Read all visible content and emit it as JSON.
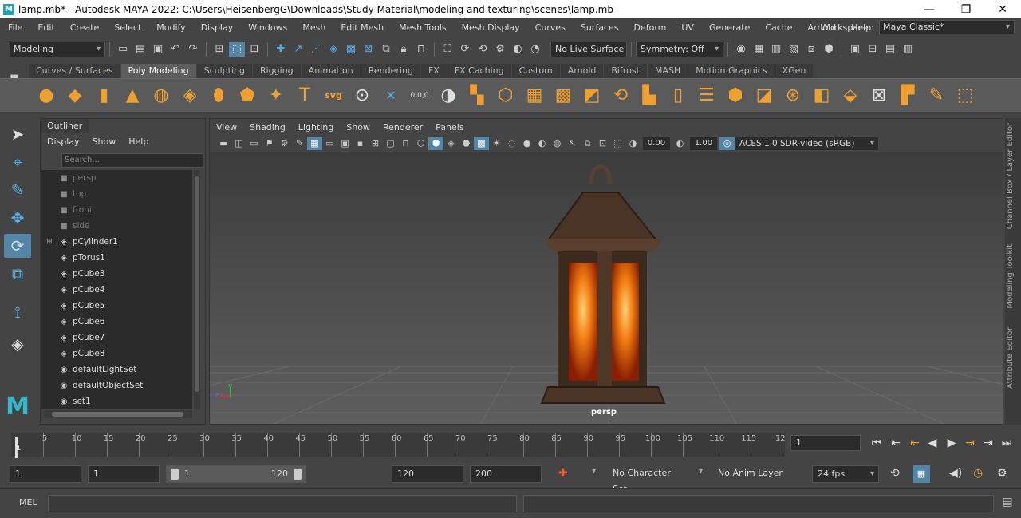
{
  "window": {
    "title": "lamp.mb* - Autodesk MAYA 2022: C:\\Users\\HeisenbergG\\Downloads\\Study Material\\modeling and texturing\\scenes\\lamp.mb",
    "logo": "M",
    "minimize": "—",
    "restore": "❐",
    "close": "✕"
  },
  "menubar": {
    "items": [
      "File",
      "Edit",
      "Create",
      "Select",
      "Modify",
      "Display",
      "Windows",
      "Mesh",
      "Edit Mesh",
      "Mesh Tools",
      "Mesh Display",
      "Curves",
      "Surfaces",
      "Deform",
      "UV",
      "Generate",
      "Cache",
      "Arnold",
      "Help"
    ],
    "workspace_label": "Workspace :",
    "workspace_value": "Maya Classic*"
  },
  "statusline": {
    "mode": "Modeling",
    "live_surface": "No Live Surface",
    "symmetry": "Symmetry: Off"
  },
  "shelf": {
    "tabs": [
      "Curves / Surfaces",
      "Poly Modeling",
      "Sculpting",
      "Rigging",
      "Animation",
      "Rendering",
      "FX",
      "FX Caching",
      "Custom",
      "Arnold",
      "Bifrost",
      "MASH",
      "Motion Graphics",
      "XGen"
    ],
    "active_tab": "Poly Modeling",
    "tools": [
      "sphere-icon",
      "cube-icon",
      "cylinder-icon",
      "cone-icon",
      "torus-icon",
      "plane-icon",
      "disc-icon",
      "platonic-icon",
      "sweep-icon",
      "type-icon",
      "svg-icon",
      "measure-icon",
      "snap-icon",
      "sphere-polygon-icon",
      "combine-icon",
      "separate-icon",
      "smooth-icon",
      "extrude-icon",
      "bridge-icon",
      "bevel-icon",
      "multicut-icon",
      "target-weld-icon",
      "offset-icon",
      "bevel2-icon",
      "fill-icon",
      "sculpt-icon",
      "quad-draw-icon",
      "bridge2-icon",
      "unfold-icon",
      "pencil-icon",
      "uv-icon"
    ],
    "svg_label": "svg",
    "type_label": "T",
    "snap_value": "0,0,0"
  },
  "outliner": {
    "tab": "Outliner",
    "menu": [
      "Display",
      "Show",
      "Help"
    ],
    "search_placeholder": "Search...",
    "items": [
      {
        "label": "persp",
        "icon": "camera-icon",
        "dim": true
      },
      {
        "label": "top",
        "icon": "camera-icon",
        "dim": true
      },
      {
        "label": "front",
        "icon": "camera-icon",
        "dim": true
      },
      {
        "label": "side",
        "icon": "camera-icon",
        "dim": true
      },
      {
        "label": "pCylinder1",
        "icon": "mesh-icon",
        "dim": false,
        "expand": true
      },
      {
        "label": "pTorus1",
        "icon": "mesh-icon",
        "dim": false
      },
      {
        "label": "pCube3",
        "icon": "mesh-icon",
        "dim": false
      },
      {
        "label": "pCube4",
        "icon": "mesh-icon",
        "dim": false
      },
      {
        "label": "pCube5",
        "icon": "mesh-icon",
        "dim": false
      },
      {
        "label": "pCube6",
        "icon": "mesh-icon",
        "dim": false
      },
      {
        "label": "pCube7",
        "icon": "mesh-icon",
        "dim": false
      },
      {
        "label": "pCube8",
        "icon": "mesh-icon",
        "dim": false
      },
      {
        "label": "defaultLightSet",
        "icon": "set-icon",
        "dim": false
      },
      {
        "label": "defaultObjectSet",
        "icon": "set-icon",
        "dim": false
      },
      {
        "label": "set1",
        "icon": "set-icon",
        "dim": false
      }
    ]
  },
  "viewport": {
    "menu": [
      "View",
      "Shading",
      "Lighting",
      "Show",
      "Renderer",
      "Panels"
    ],
    "exposure": "0.00",
    "gamma": "1.00",
    "color_space": "ACES 1.0 SDR-video (sRGB)",
    "camera_label": "persp",
    "axis_y": "y",
    "axis_z": "z"
  },
  "side_panels": [
    "Channel Box / Layer Editor",
    "Modeling Toolkit",
    "Attribute Editor"
  ],
  "timeline": {
    "ticks": [
      "5",
      "10",
      "15",
      "20",
      "25",
      "30",
      "35",
      "40",
      "45",
      "50",
      "55",
      "60",
      "65",
      "70",
      "75",
      "80",
      "85",
      "90",
      "95",
      "100",
      "105",
      "110",
      "115",
      "12"
    ],
    "first_tick": "1",
    "current_frame": "1"
  },
  "range": {
    "start": "1",
    "playback_start": "1",
    "slider_min": "1",
    "slider_max": "120",
    "playback_end": "120",
    "end": "200",
    "character_set": "No Character Set",
    "anim_layer": "No Anim Layer",
    "fps": "24 fps"
  },
  "commandline": {
    "mel_label": "MEL"
  },
  "colors": {
    "accent": "#5285a6",
    "shelf_orange": "#f0a030",
    "maya_teal": "#35b7c9"
  }
}
